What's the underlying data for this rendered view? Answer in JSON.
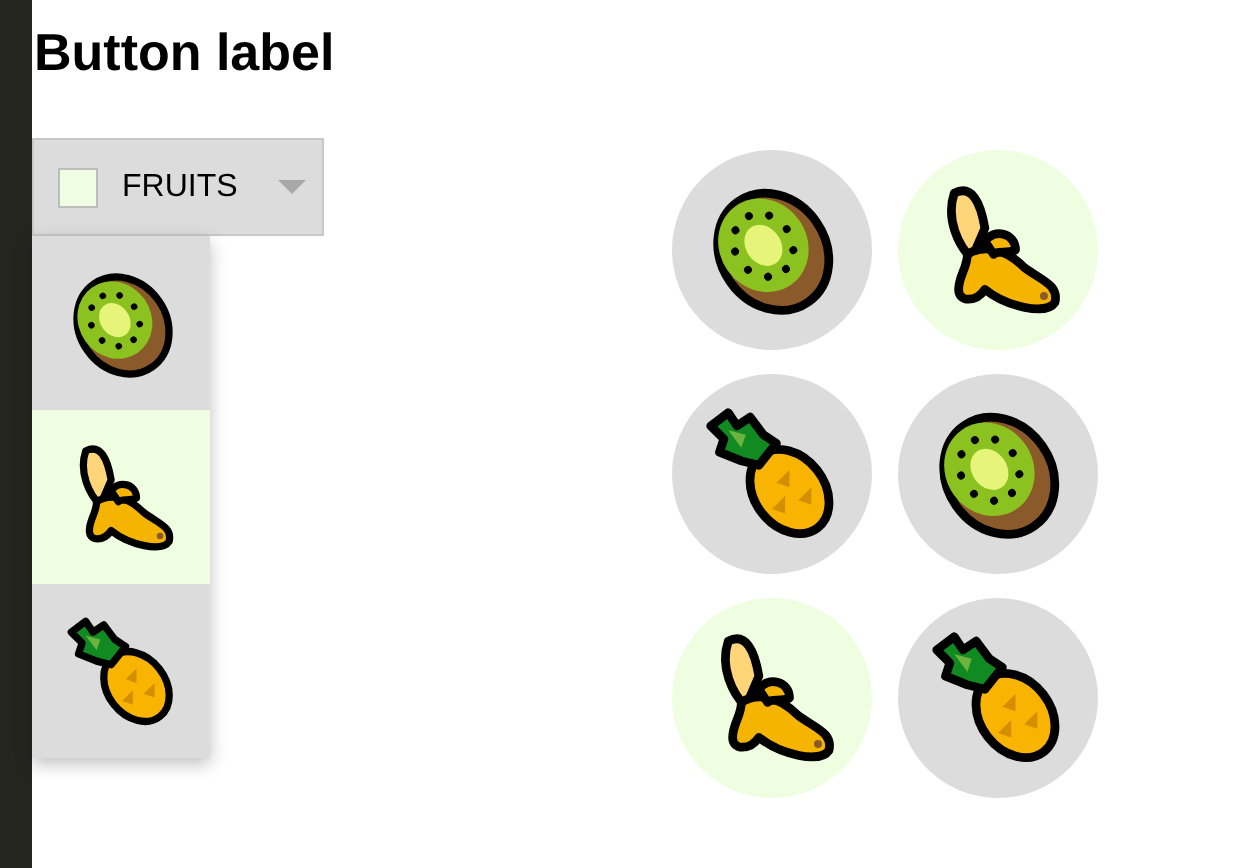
{
  "title": "Button label",
  "dropdown": {
    "label": "FRUITS",
    "expanded": true,
    "color": "#effde0"
  },
  "menu_items": [
    {
      "kind": "kiwi",
      "selected": false
    },
    {
      "kind": "banana",
      "selected": true
    },
    {
      "kind": "pineapple",
      "selected": false
    }
  ],
  "grid_items": [
    {
      "kind": "kiwi",
      "selected": false
    },
    {
      "kind": "banana",
      "selected": true
    },
    {
      "kind": "pineapple",
      "selected": false
    },
    {
      "kind": "kiwi",
      "selected": false
    },
    {
      "kind": "banana",
      "selected": true
    },
    {
      "kind": "pineapple",
      "selected": false
    }
  ]
}
